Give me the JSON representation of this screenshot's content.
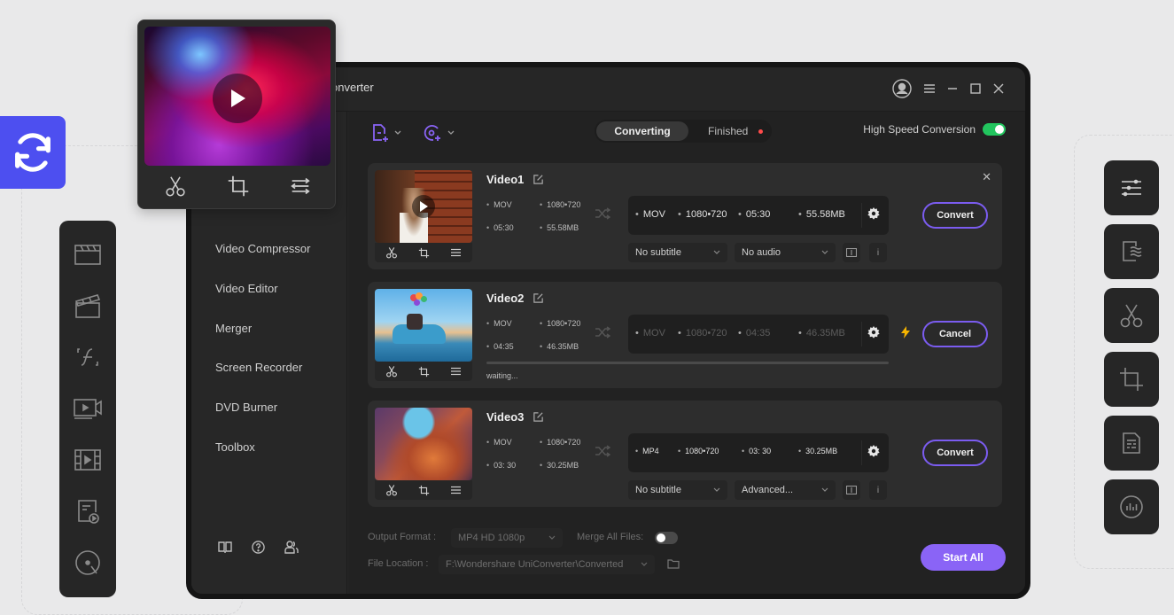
{
  "app": {
    "title": "onverter",
    "window_controls": [
      "account-icon",
      "menu-icon",
      "minimize-icon",
      "maximize-icon",
      "close-icon"
    ]
  },
  "toolbar": {
    "add_file_icon": "add-file-icon",
    "add_dvd_icon": "add-dvd-icon",
    "tabs": [
      {
        "label": "Converting",
        "active": true
      },
      {
        "label": "Finished",
        "active": false,
        "has_notification": true
      }
    ],
    "high_speed": {
      "label": "High Speed Conversion",
      "enabled": true
    }
  },
  "sidebar": {
    "items": [
      {
        "label": "Video Compressor"
      },
      {
        "label": "Video Editor"
      },
      {
        "label": "Merger"
      },
      {
        "label": "Screen Recorder"
      },
      {
        "label": "DVD Burner"
      },
      {
        "label": "Toolbox"
      }
    ],
    "footer_icons": [
      "book-icon",
      "help-icon",
      "users-icon"
    ]
  },
  "videos": [
    {
      "name": "Video1",
      "source": {
        "format": "MOV",
        "resolution": "1080•720",
        "duration": "05:30",
        "size": "55.58MB"
      },
      "target": {
        "format": "MOV",
        "resolution": "1080•720",
        "duration": "05:30",
        "size": "55.58MB"
      },
      "subtitle": "No subtitle",
      "audio": "No audio",
      "action": "Convert",
      "state": "ready"
    },
    {
      "name": "Video2",
      "source": {
        "format": "MOV",
        "resolution": "1080•720",
        "duration": "04:35",
        "size": "46.35MB"
      },
      "target": {
        "format": "MOV",
        "resolution": "1080•720",
        "duration": "04:35",
        "size": "46.35MB"
      },
      "status": "waiting...",
      "action": "Cancel",
      "state": "waiting"
    },
    {
      "name": "Video3",
      "source": {
        "format": "MOV",
        "resolution": "1080•720",
        "duration": "03: 30",
        "size": "30.25MB"
      },
      "target": {
        "format": "MP4",
        "resolution": "1080•720",
        "duration": "03: 30",
        "size": "30.25MB"
      },
      "subtitle": "No subtitle",
      "audio": "Advanced...",
      "action": "Convert",
      "state": "ready"
    }
  ],
  "footer": {
    "output_format_label": "Output Format :",
    "output_format_value": "MP4 HD 1080p",
    "merge_label": "Merge All Files:",
    "merge_enabled": false,
    "file_location_label": "File Location :",
    "file_location_value": "F:\\Wondershare UniConverter\\Converted",
    "start_all": "Start All"
  },
  "colors": {
    "accent": "#8a64f6",
    "accent_border": "#7b5cf0",
    "toggle_on": "#22c55e",
    "badge_blue": "#4d4ff0",
    "notify_red": "#ff4b4b",
    "bolt": "#f5b400"
  },
  "left_strip_icons": [
    "clapperboard-icon",
    "clapperboard-open-icon",
    "function-icon",
    "screen-record-icon",
    "film-play-icon",
    "document-play-icon",
    "disc-icon"
  ],
  "right_tool_icons": [
    "sliders-icon",
    "document-wave-icon",
    "scissors-icon",
    "crop-icon",
    "document-lines-icon",
    "audio-levels-icon"
  ]
}
